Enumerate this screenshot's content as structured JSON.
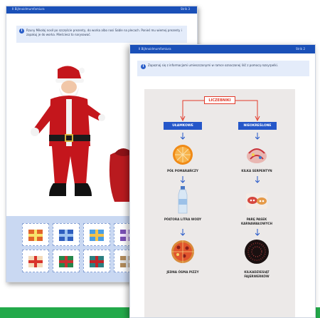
{
  "page1": {
    "header_title": "II Bijhnoidmumfamiura",
    "header_page": "Strik 3",
    "instruction": "Rzuny Mikołaj nosił po szczęście prezenty, do worka albo nosi Sable na plecach. Ponieś mu wiemej prezenty i zapakuj je do worka. Mieściesz to narysować.",
    "info_icon_glyph": "i"
  },
  "page2": {
    "header_title": "II Bijhnoidmumfamiura",
    "header_page": "Strik 2",
    "instruction": "Zapoznaj się z informacjami umieszczonymi w ramce oznaczonej liść z pomocą rozsyrpelki.",
    "info_icon_glyph": "i"
  },
  "diagram": {
    "main_label": "LICZEBNIKI",
    "left_category": "UŁAMKOWE",
    "right_category": "NIEOKREŚLONE",
    "left_items": [
      "PÓŁ POMARAŃCZY",
      "PÓŁTORA LITRA WODY",
      "JEDNA ÓSMA PIZZY"
    ],
    "right_items": [
      "KILKA SERPENTYN",
      "PARĘ PASEK KARNAWAŁOWYCH",
      "KILKADZIESIĄT FAJERWERKÓW"
    ]
  },
  "colors": {
    "header_blue": "#1a50b8",
    "category_blue": "#2557c9",
    "accent_red": "#e23a2a",
    "instruction_bg": "#e4ecfa",
    "gift_panel_bg": "#c9d8f2",
    "diagram_bg": "#ece9e8",
    "green_strip": "#23a94a"
  }
}
